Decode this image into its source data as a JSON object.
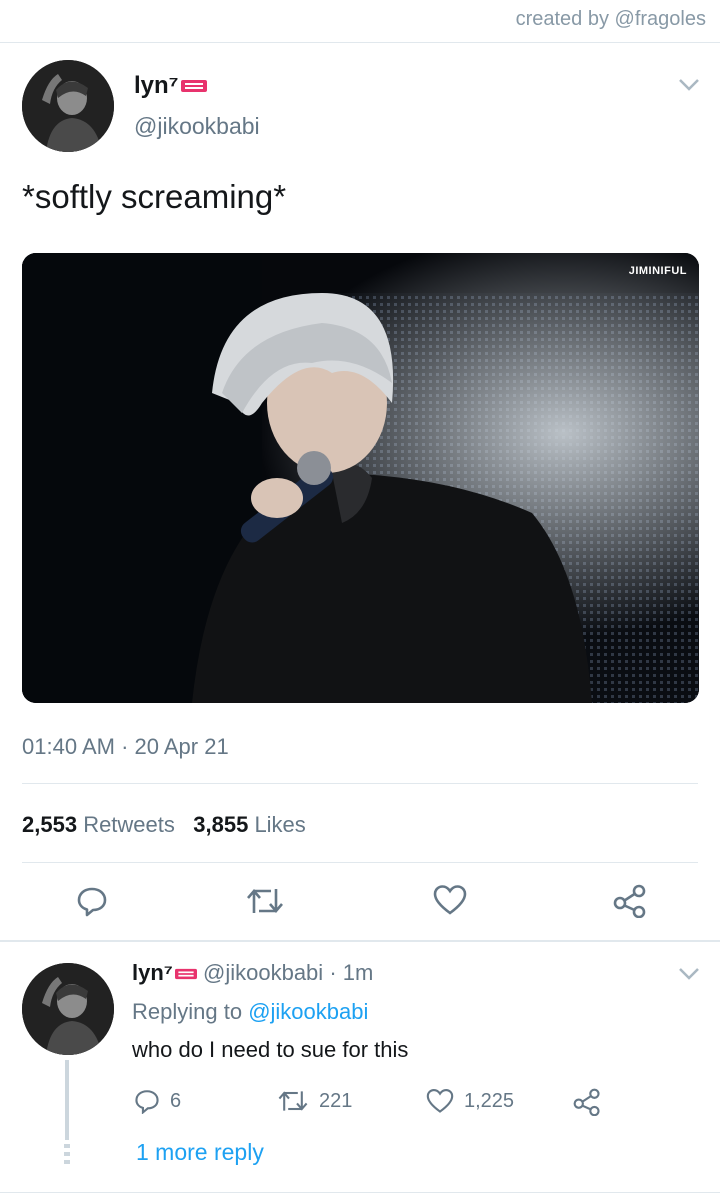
{
  "watermark": "created by @fragoles",
  "tweet": {
    "author_name": "lyn⁷",
    "author_handle": "@jikookbabi",
    "text": "*softly screaming*",
    "media_watermark": "JIMINIFUL",
    "timestamp": "01:40 AM · 20 Apr 21",
    "retweets_count": "2,553",
    "retweets_label": "Retweets",
    "likes_count": "3,855",
    "likes_label": "Likes",
    "actions": [
      "reply-icon",
      "retweet-icon",
      "like-icon",
      "share-icon"
    ]
  },
  "reply": {
    "author_name": "lyn⁷",
    "author_handle": "@jikookbabi",
    "time": "· 1m",
    "replying_prefix": "Replying to",
    "replying_to": "@jikookbabi",
    "text": "who do I need to sue for this",
    "reply_count": "6",
    "retweet_count": "221",
    "like_count": "1,225",
    "more_replies": "1 more reply"
  },
  "colors": {
    "link": "#1da1f2",
    "muted": "#657786",
    "divider": "#e1e8ed",
    "ticket_emoji": "#e8336d"
  }
}
